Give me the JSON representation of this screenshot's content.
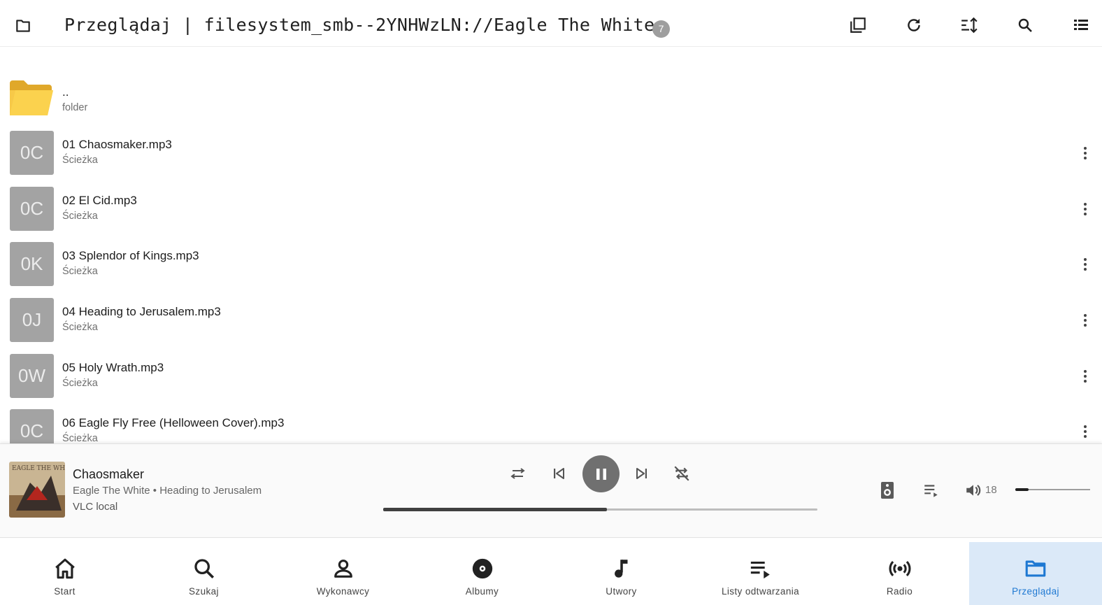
{
  "header": {
    "title": "Przeglądaj | filesystem_smb--2YNHWzLN://Eagle The White",
    "count": "7",
    "actions": [
      "select-icon",
      "refresh-icon",
      "sort-icon",
      "search-icon",
      "list-view-icon"
    ]
  },
  "list": {
    "parent": {
      "title": "..",
      "subtitle": "folder"
    },
    "items": [
      {
        "thumb": "0C",
        "title": "01 Chaosmaker.mp3",
        "subtitle": "Ścieżka"
      },
      {
        "thumb": "0C",
        "title": "02 El Cid.mp3",
        "subtitle": "Ścieżka"
      },
      {
        "thumb": "0K",
        "title": "03 Splendor of Kings.mp3",
        "subtitle": "Ścieżka"
      },
      {
        "thumb": "0J",
        "title": "04 Heading to Jerusalem.mp3",
        "subtitle": "Ścieżka"
      },
      {
        "thumb": "0W",
        "title": "05 Holy Wrath.mp3",
        "subtitle": "Ścieżka"
      },
      {
        "thumb": "0C",
        "title": "06 Eagle Fly Free (Helloween Cover).mp3",
        "subtitle": "Ścieżka"
      }
    ]
  },
  "player": {
    "track": "Chaosmaker",
    "subtitle": "Eagle The White • Heading to Jerusalem",
    "output": "VLC local",
    "volume": "18",
    "progress_fraction": 0.515,
    "volume_fraction": 0.18,
    "cover_text": "EAGLE THE WHITE"
  },
  "nav": {
    "items": [
      {
        "label": "Start",
        "icon": "home-icon"
      },
      {
        "label": "Szukaj",
        "icon": "search-icon"
      },
      {
        "label": "Wykonawcy",
        "icon": "person-icon"
      },
      {
        "label": "Albumy",
        "icon": "album-icon"
      },
      {
        "label": "Utwory",
        "icon": "music-note-icon"
      },
      {
        "label": "Listy odtwarzania",
        "icon": "playlist-icon"
      },
      {
        "label": "Radio",
        "icon": "radio-icon"
      },
      {
        "label": "Przeglądaj",
        "icon": "folder-icon"
      }
    ],
    "active_index": 7
  },
  "colors": {
    "accent": "#1e78d2",
    "active_nav_bg": "#dbe9f8",
    "thumb_bg": "#a3a3a3",
    "folder": "#f5c518"
  }
}
